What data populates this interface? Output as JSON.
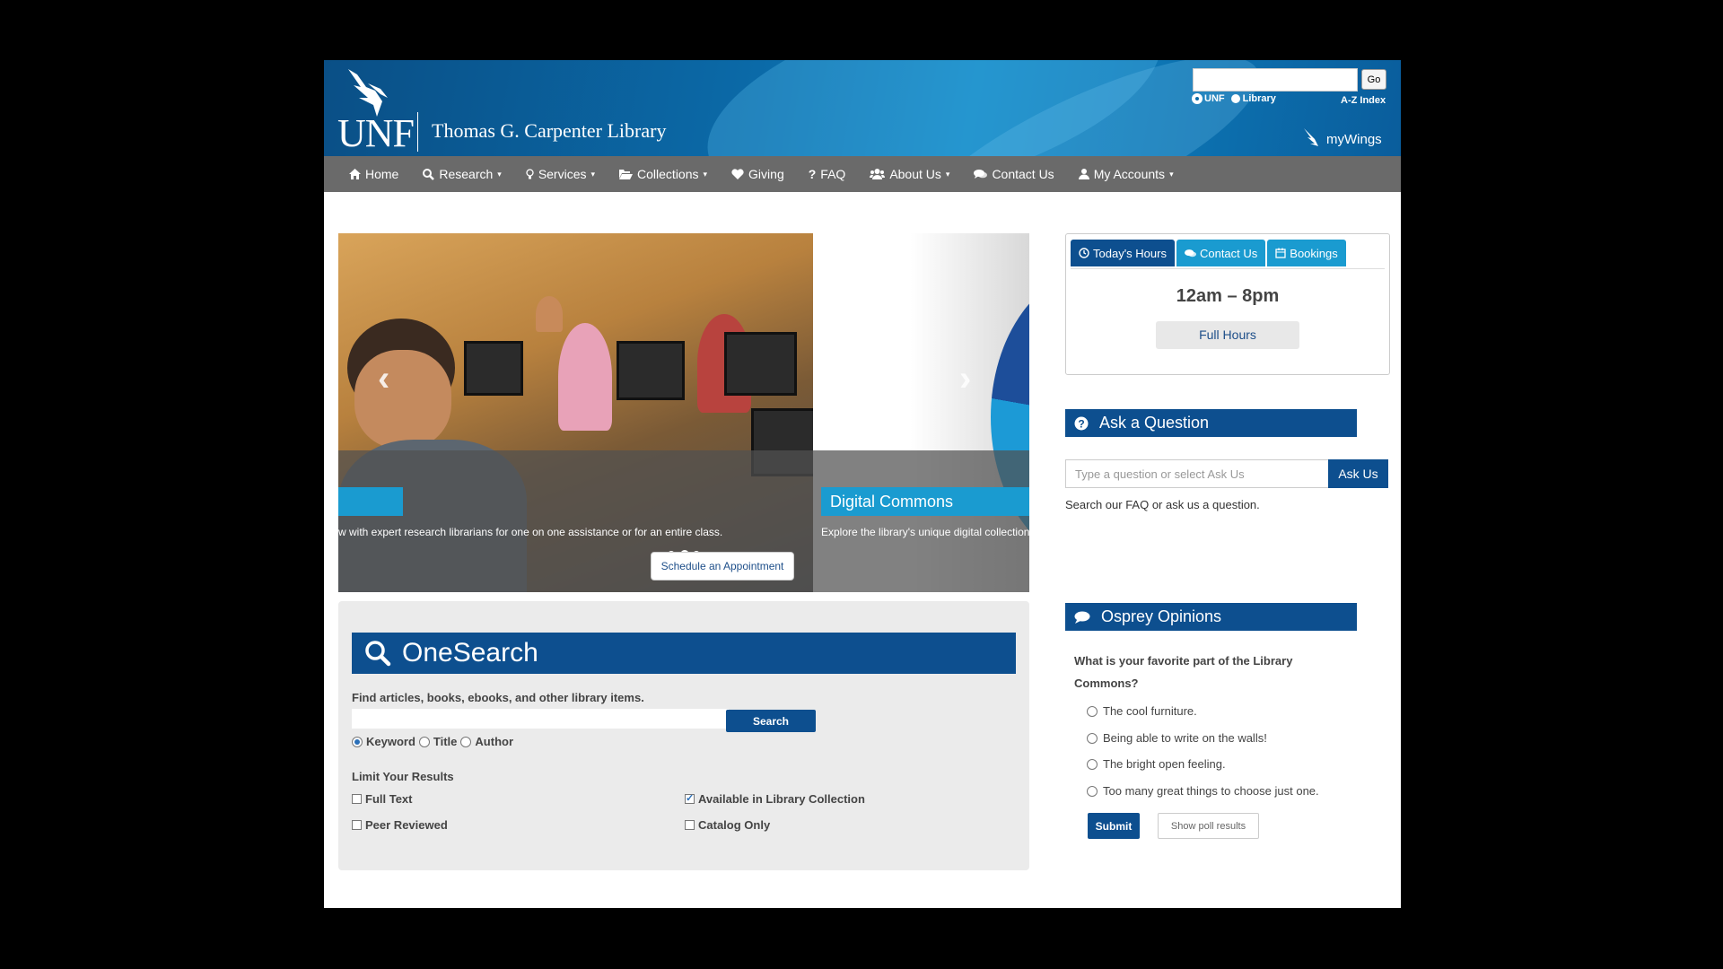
{
  "header": {
    "logo_text": "UNF",
    "library_name": "Thomas G. Carpenter Library",
    "search_button": "Go",
    "scope_options": [
      "UNF",
      "Library"
    ],
    "az_index": "A-Z Index",
    "mywings": "myWings"
  },
  "nav": {
    "items": [
      {
        "label": "Home",
        "icon": "home-icon",
        "dropdown": false
      },
      {
        "label": "Research",
        "icon": "search-icon",
        "dropdown": true
      },
      {
        "label": "Services",
        "icon": "lightbulb-icon",
        "dropdown": true
      },
      {
        "label": "Collections",
        "icon": "folder-open-icon",
        "dropdown": true
      },
      {
        "label": "Giving",
        "icon": "heart-icon",
        "dropdown": false
      },
      {
        "label": "FAQ",
        "icon": "question-icon",
        "dropdown": false
      },
      {
        "label": "About Us",
        "icon": "users-icon",
        "dropdown": true
      },
      {
        "label": "Contact Us",
        "icon": "comments-icon",
        "dropdown": false
      },
      {
        "label": "My Accounts",
        "icon": "user-icon",
        "dropdown": true
      }
    ]
  },
  "carousel": {
    "slide1_caption_text": "w with expert research librarians for one on one assistance or for an entire class.",
    "slide1_button": "Schedule an Appointment",
    "slide2_title": "Digital Commons",
    "slide2_caption_text": "Explore the library's unique digital collection"
  },
  "onesearch": {
    "title": "OneSearch",
    "description": "Find articles, books, ebooks, and other library items.",
    "search_button": "Search",
    "scope": [
      {
        "label": "Keyword",
        "selected": true
      },
      {
        "label": "Title",
        "selected": false
      },
      {
        "label": "Author",
        "selected": false
      }
    ],
    "limit_title": "Limit Your Results",
    "limits": [
      {
        "label": "Full Text",
        "checked": false
      },
      {
        "label": "Available in Library Collection",
        "checked": true
      },
      {
        "label": "Peer Reviewed",
        "checked": false
      },
      {
        "label": "Catalog Only",
        "checked": false
      }
    ]
  },
  "hours": {
    "tabs": [
      {
        "label": "Today's Hours",
        "icon": "clock-icon",
        "active": true
      },
      {
        "label": "Contact Us",
        "icon": "comments-icon",
        "active": false
      },
      {
        "label": "Bookings",
        "icon": "calendar-icon",
        "active": false
      }
    ],
    "value": "12am – 8pm",
    "full_hours_button": "Full Hours"
  },
  "ask": {
    "title": "Ask a Question",
    "placeholder": "Type a question or select Ask Us",
    "button": "Ask Us",
    "help": "Search our FAQ or ask us a question."
  },
  "poll": {
    "title": "Osprey Opinions",
    "question": "What is your favorite part of the Library Commons?",
    "options": [
      "The cool furniture.",
      "Being able to write on the walls!",
      "The bright open feeling.",
      "Too many great things to choose just one."
    ],
    "submit": "Submit",
    "show_results": "Show poll results"
  },
  "colors": {
    "primary_blue": "#0d4f8f",
    "accent_cyan": "#1a9bd0",
    "nav_gray": "#6a6a6a",
    "header_blue": "#0b6aa8"
  }
}
